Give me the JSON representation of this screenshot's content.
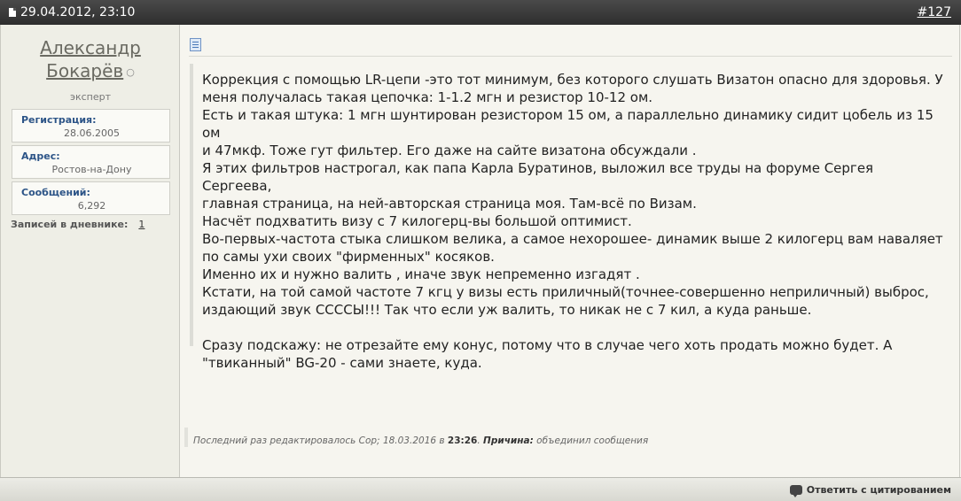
{
  "header": {
    "date": "29.04.2012, 23:10",
    "post_number": "#127"
  },
  "user": {
    "name_line1": "Александр",
    "name_line2": "Бокарёв",
    "status_icon": "offline-dot",
    "title": "эксперт",
    "info": [
      {
        "label": "Регистрация:",
        "value": "28.06.2005"
      },
      {
        "label": "Адрес:",
        "value": "Ростов-на-Дону"
      },
      {
        "label": "Сообщений:",
        "value": "6,292"
      }
    ],
    "diary_label": "Записей в дневнике:",
    "diary_count": "1"
  },
  "post": {
    "icon": "post-document-icon",
    "lines": [
      "Коррекция с помощью LR-цепи -это тот минимум, без которого слушать Визатон опасно для здоровья. У",
      "меня получалась такая цепочка: 1-1.2 мгн и резистор 10-12 ом.",
      "Есть и такая штука: 1 мгн шунтирован резистором 15 ом, а параллельно динамику сидит цобель из 15 ом",
      "и 47мкф. Тоже гут фильтер. Его даже на сайте визатона обсуждали .",
      "Я этих фильтров настрогал, как папа Карла Буратинов, выложил все труды на форуме Сергея Сергеева,",
      "главная страница, на ней-авторская страница моя. Там-всё по Визам.",
      "Насчёт подхватить визу с 7 килогерц-вы большой оптимист.",
      "Во-первых-частота стыка слишком велика, а самое нехорошее- динамик выше 2 килогерц вам наваляет",
      "по самы ухи своих \"фирменных\" косяков.",
      "Именно их и нужно валить , иначе звук непременно изгадят .",
      "Кстати, на той самой частоте 7 кгц у визы есть приличный(точнее-совершенно неприличный) выброс,",
      "издающий звук СССCЫ!!! Так что если уж валить, то никак не с 7 кил, а куда раньше.",
      "",
      "Сразу подскажу: не отрезайте ему конус, потому что в случае чего хоть продать можно будет. А",
      "\"твиканный\" BG-20 - сами знаете, куда."
    ],
    "edit_prefix": "Последний раз редактировалось Сор; 18.03.2016 в ",
    "edit_time": "23:26",
    "edit_dot": ". ",
    "edit_reason_label": "Причина:",
    "edit_reason": " объединил сообщения"
  },
  "footer": {
    "reply_label": "Ответить с цитированием",
    "reply_icon": "quote-bubble-icon"
  }
}
